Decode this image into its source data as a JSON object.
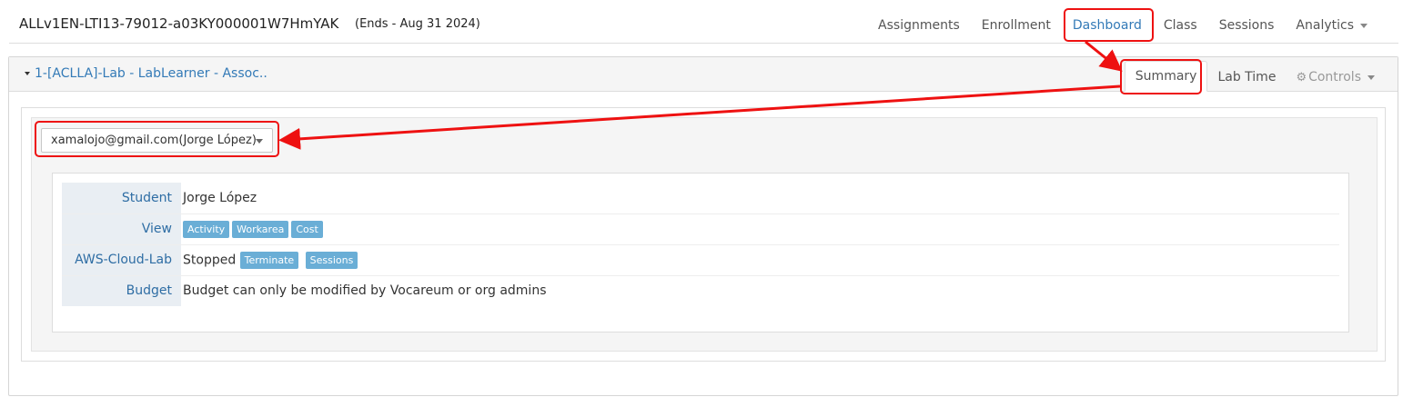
{
  "header": {
    "course_title": "ALLv1EN-LTI13-79012-a03KY000001W7HmYAK",
    "ends": "(Ends - Aug 31 2024)"
  },
  "top_nav": {
    "assignments": "Assignments",
    "enrollment": "Enrollment",
    "dashboard": "Dashboard",
    "class": "Class",
    "sessions": "Sessions",
    "analytics": "Analytics"
  },
  "panel": {
    "lab_title": "1-[ACLLA]-Lab - LabLearner - Assoc..",
    "tabs": {
      "summary": "Summary",
      "lab_time": "Lab Time",
      "controls": "Controls"
    },
    "student_select": "xamalojo@gmail.com(Jorge López)",
    "details": {
      "student_label": "Student",
      "student_value": "Jorge López",
      "view_label": "View",
      "view_buttons": {
        "activity": "Activity",
        "workarea": "Workarea",
        "cost": "Cost"
      },
      "aws_label": "AWS-Cloud-Lab",
      "aws_status": "Stopped",
      "aws_buttons": {
        "terminate": "Terminate",
        "sessions": "Sessions"
      },
      "budget_label": "Budget",
      "budget_value": "Budget can only be modified by Vocareum or org admins"
    }
  },
  "icons": {
    "controls": "gear-icon",
    "dropdown": "caret-down-icon",
    "collapse": "triangle-down-icon"
  },
  "colors": {
    "link": "#337ab7",
    "badge": "#6aaed6",
    "annotation": "#ee1111",
    "label_bg": "#e9eef3"
  }
}
